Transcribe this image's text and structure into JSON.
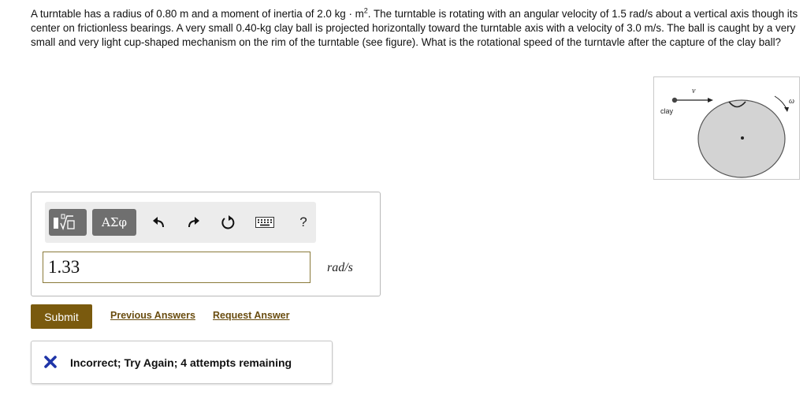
{
  "problem": {
    "text_before_sup": "A turntable has a radius of 0.80 m and a moment of inertia of 2.0 kg · m",
    "sup": "2",
    "text_after_sup": ". The turntable is rotating with an angular velocity of 1.5 rad/s about a vertical axis though its center on frictionless bearings. A very small 0.40-kg clay ball is projected horizontally toward the turntable axis with a velocity of 3.0 m/s. The ball is caught by a very small and very light cup-shaped mechanism on the rim of the turntable (see figure). What is the rotational speed of the turntavle after the capture of the clay ball?"
  },
  "figure": {
    "ball_label": "clay",
    "velocity_label": "v⃗",
    "omega_label": "ω⃗",
    "disk_color": "#d3d3d3"
  },
  "toolbar": {
    "template_icon": "math-template-icon",
    "greek_label": "ΑΣφ",
    "undo_icon": "undo-icon",
    "redo_icon": "redo-icon",
    "reset_icon": "reset-icon",
    "keyboard_icon": "keyboard-icon",
    "help_label": "?"
  },
  "answer": {
    "value": "1.33",
    "unit": "rad/s"
  },
  "actions": {
    "submit_label": "Submit",
    "previous_label": "Previous Answers",
    "request_label": "Request Answer"
  },
  "feedback": {
    "icon": "x-icon",
    "message": "Incorrect; Try Again; 4 attempts remaining"
  },
  "colors": {
    "accent": "#7a5a0e",
    "link": "#6a4d10",
    "error": "#1f35a8"
  }
}
